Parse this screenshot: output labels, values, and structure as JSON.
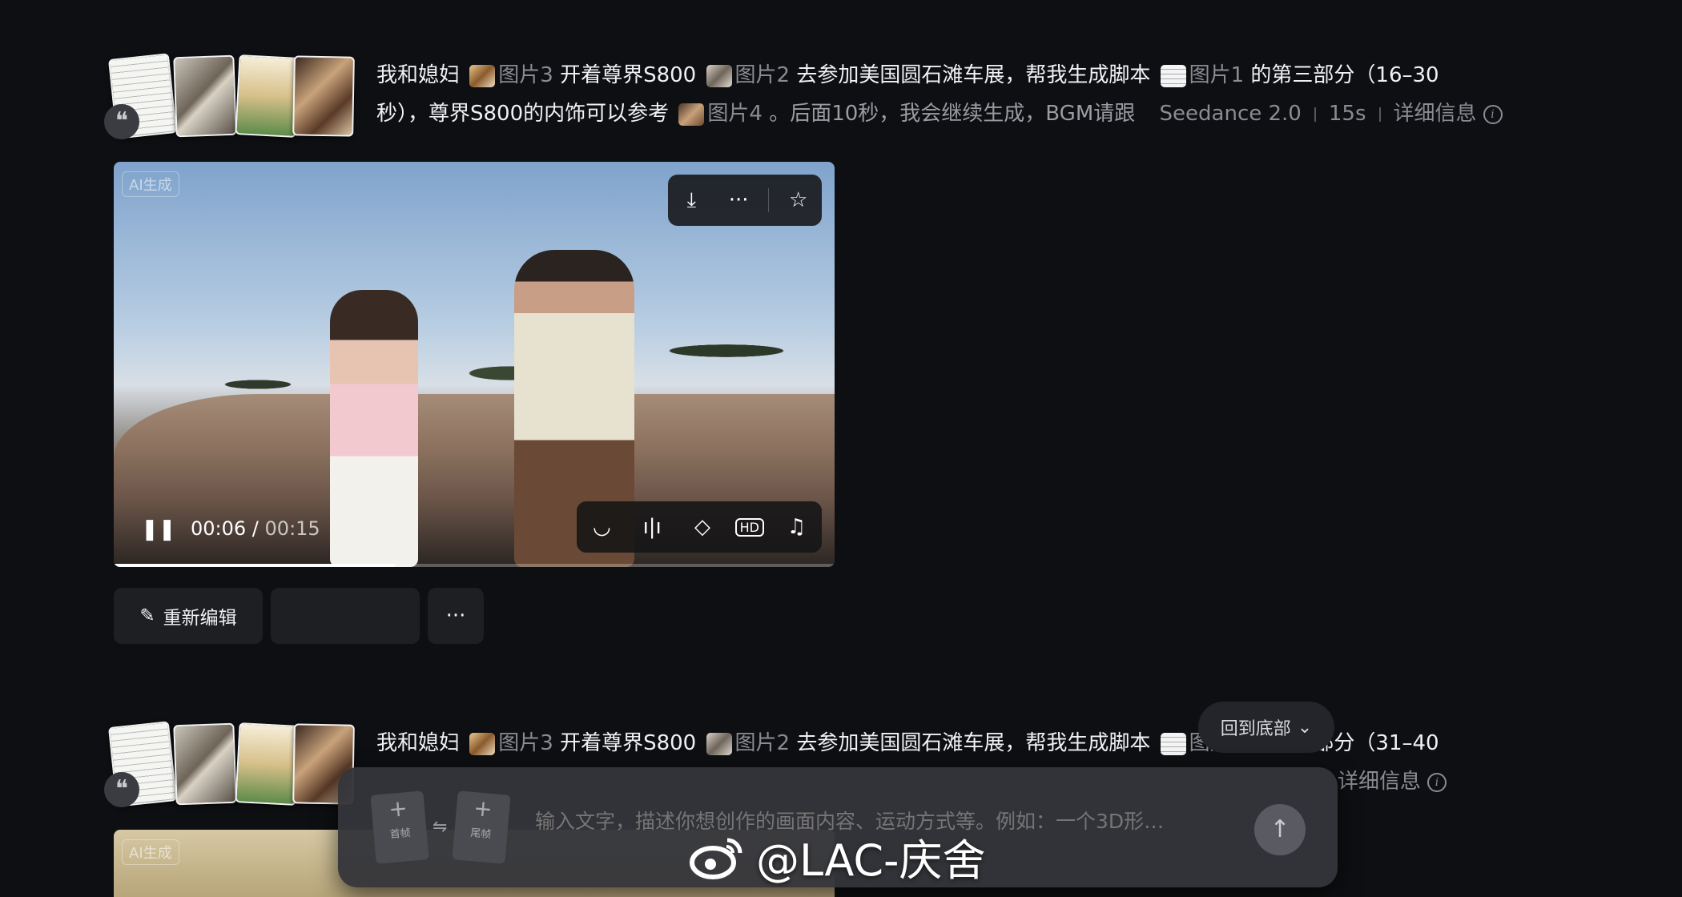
{
  "entries": [
    {
      "prompt_lines": {
        "p1": "我和媳妇",
        "ref_a": "图片3",
        "p2": "开着尊界S800",
        "ref_b": "图片2",
        "p3": "去参加美国圆石滩车展，帮我生成脚本",
        "ref_c": "图片1",
        "p4": "的第三部分（16–30",
        "p5": "秒），尊界S800的内饰可以参考",
        "ref_d": "图片4",
        "p6": "。后面10秒，我会继续生成，BGM请跟"
      },
      "model": "Seedance 2.0",
      "duration": "15s",
      "details_label": "详细信息",
      "ai_badge": "AI生成",
      "current_time": "00:06 /",
      "total_time": "00:15",
      "progress_fraction": 0.39,
      "actions": {
        "edit_label": "重新编辑",
        "more_label": "···"
      }
    },
    {
      "prompt_lines": {
        "p1": "我和媳妇",
        "ref_a": "图片3",
        "p2": "开着尊界S800",
        "ref_b": "图片2",
        "p3": "去参加美国圆石滩车展，帮我生成脚本",
        "ref_c": "图片1",
        "p4": "的第四部分（31–40"
      },
      "details_label": "详细信息",
      "ai_badge": "AI生成"
    }
  ],
  "icons": {
    "download": "download-icon",
    "more": "more-icon",
    "favorite": "star-icon",
    "lip_sync": "lips-icon",
    "audio": "audio-wave-icon",
    "interpolate": "diamond-icon",
    "hd": "hd-icon",
    "music": "music-note-icon",
    "pause": "pause-icon"
  },
  "back_to_bottom": "回到底部",
  "composer": {
    "first_frame": "首帧",
    "last_frame": "尾帧",
    "placeholder": "输入文字，描述你想创作的画面内容、运动方式等。例如：一个3D形…"
  },
  "watermark": "@LAC-庆舍"
}
